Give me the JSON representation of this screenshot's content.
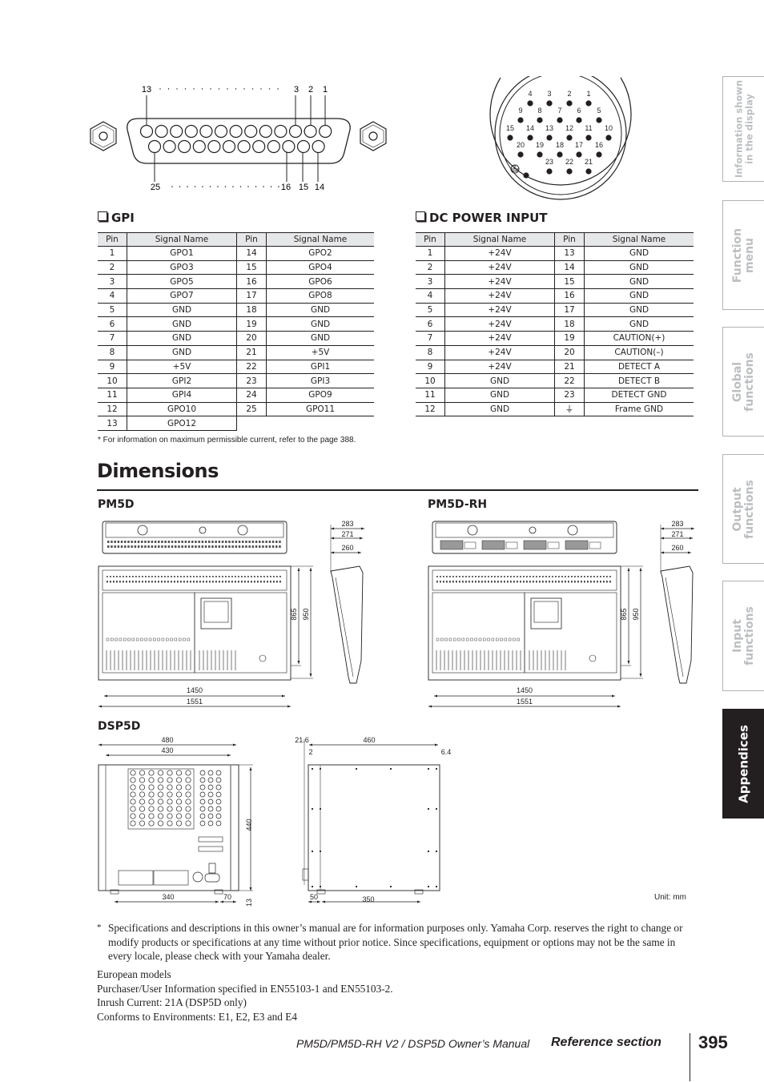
{
  "gpi_connector": {
    "top_labels": [
      "13",
      "3",
      "2",
      "1"
    ],
    "bottom_labels": [
      "25",
      "16",
      "15",
      "14"
    ]
  },
  "dc_connector": {
    "pin_labels": [
      {
        "n": "4",
        "r": 0,
        "c": 0
      },
      {
        "n": "3",
        "r": 0,
        "c": 1
      },
      {
        "n": "2",
        "r": 0,
        "c": 2
      },
      {
        "n": "1",
        "r": 0,
        "c": 3
      },
      {
        "n": "9",
        "r": 1,
        "c": 0
      },
      {
        "n": "8",
        "r": 1,
        "c": 1
      },
      {
        "n": "7",
        "r": 1,
        "c": 2
      },
      {
        "n": "6",
        "r": 1,
        "c": 3
      },
      {
        "n": "5",
        "r": 1,
        "c": 4
      },
      {
        "n": "15",
        "r": 2,
        "c": 0
      },
      {
        "n": "14",
        "r": 2,
        "c": 1
      },
      {
        "n": "13",
        "r": 2,
        "c": 2
      },
      {
        "n": "12",
        "r": 2,
        "c": 3
      },
      {
        "n": "11",
        "r": 2,
        "c": 4
      },
      {
        "n": "10",
        "r": 2,
        "c": 5
      },
      {
        "n": "20",
        "r": 3,
        "c": 0
      },
      {
        "n": "19",
        "r": 3,
        "c": 1
      },
      {
        "n": "18",
        "r": 3,
        "c": 2
      },
      {
        "n": "17",
        "r": 3,
        "c": 3
      },
      {
        "n": "16",
        "r": 3,
        "c": 4
      },
      {
        "n": "23",
        "r": 4,
        "c": 0
      },
      {
        "n": "22",
        "r": 4,
        "c": 1
      },
      {
        "n": "21",
        "r": 4,
        "c": 2
      }
    ]
  },
  "gpi": {
    "heading": "GPI",
    "columns": [
      "Pin",
      "Signal Name",
      "Pin",
      "Signal Name"
    ],
    "rows": [
      [
        "1",
        "GPO1",
        "14",
        "GPO2"
      ],
      [
        "2",
        "GPO3",
        "15",
        "GPO4"
      ],
      [
        "3",
        "GPO5",
        "16",
        "GPO6"
      ],
      [
        "4",
        "GPO7",
        "17",
        "GPO8"
      ],
      [
        "5",
        "GND",
        "18",
        "GND"
      ],
      [
        "6",
        "GND",
        "19",
        "GND"
      ],
      [
        "7",
        "GND",
        "20",
        "GND"
      ],
      [
        "8",
        "GND",
        "21",
        "+5V"
      ],
      [
        "9",
        "+5V",
        "22",
        "GPI1"
      ],
      [
        "10",
        "GPI2",
        "23",
        "GPI3"
      ],
      [
        "11",
        "GPI4",
        "24",
        "GPO9"
      ],
      [
        "12",
        "GPO10",
        "25",
        "GPO11"
      ],
      [
        "13",
        "GPO12",
        "",
        ""
      ]
    ],
    "note": "*  For information on maximum permissible current, refer to the page 388."
  },
  "dc_power": {
    "heading": "DC POWER INPUT",
    "columns": [
      "Pin",
      "Signal Name",
      "Pin",
      "Signal Name"
    ],
    "rows": [
      [
        "1",
        "+24V",
        "13",
        "GND"
      ],
      [
        "2",
        "+24V",
        "14",
        "GND"
      ],
      [
        "3",
        "+24V",
        "15",
        "GND"
      ],
      [
        "4",
        "+24V",
        "16",
        "GND"
      ],
      [
        "5",
        "+24V",
        "17",
        "GND"
      ],
      [
        "6",
        "+24V",
        "18",
        "GND"
      ],
      [
        "7",
        "+24V",
        "19",
        "CAUTION(+)"
      ],
      [
        "8",
        "+24V",
        "20",
        "CAUTION(–)"
      ],
      [
        "9",
        "+24V",
        "21",
        "DETECT A"
      ],
      [
        "10",
        "GND",
        "22",
        "DETECT B"
      ],
      [
        "11",
        "GND",
        "23",
        "DETECT GND"
      ],
      [
        "12",
        "GND",
        "⏚",
        "Frame GND"
      ]
    ]
  },
  "dimensions": {
    "title": "Dimensions",
    "pm5d": {
      "label": "PM5D",
      "width_inner": "1450",
      "width_outer": "1551",
      "height_inner": "865",
      "height_outer": "950",
      "side_depths": [
        "283",
        "271",
        "260"
      ]
    },
    "pm5d_rh": {
      "label": "PM5D-RH",
      "width_inner": "1450",
      "width_outer": "1551",
      "height_inner": "865",
      "height_outer": "950",
      "side_depths": [
        "283",
        "271",
        "260"
      ]
    },
    "dsp5d": {
      "label": "DSP5D",
      "front_width_outer": "480",
      "front_width_inner": "430",
      "height": "440",
      "foot_height": "13",
      "foot_spacing": "340",
      "foot_offset": "70",
      "side_depth": "460",
      "side_front_offset": "21.6",
      "side_panel": "2",
      "side_rear": "6.4",
      "side_foot_offset": "50",
      "side_foot_spacing": "350"
    },
    "unit": "Unit: mm"
  },
  "disclaimer": {
    "mark": "*",
    "text": "Specifications and descriptions in this owner’s manual are for information purposes only. Yamaha Corp. reserves the right to change or modify products or specifications at any time without prior notice. Since specifications, equipment or options may not be the same in every locale, please check with your Yamaha dealer."
  },
  "european": {
    "lines": [
      "European models",
      "Purchaser/User Information specified in EN55103-1 and EN55103-2.",
      "Inrush Current: 21A (DSP5D only)",
      "Conforms to Environments: E1, E2, E3 and E4"
    ]
  },
  "footer": {
    "manual": "PM5D/PM5D-RH V2 / DSP5D Owner’s Manual",
    "section": "Reference section",
    "page": "395"
  },
  "side_tabs": [
    {
      "label": "Information shown\nin the display",
      "active": false
    },
    {
      "label": "Function\nmenu",
      "active": false
    },
    {
      "label": "Global\nfunctions",
      "active": false
    },
    {
      "label": "Output\nfunctions",
      "active": false
    },
    {
      "label": "Input\nfunctions",
      "active": false
    },
    {
      "label": "Appendices",
      "active": true
    }
  ]
}
